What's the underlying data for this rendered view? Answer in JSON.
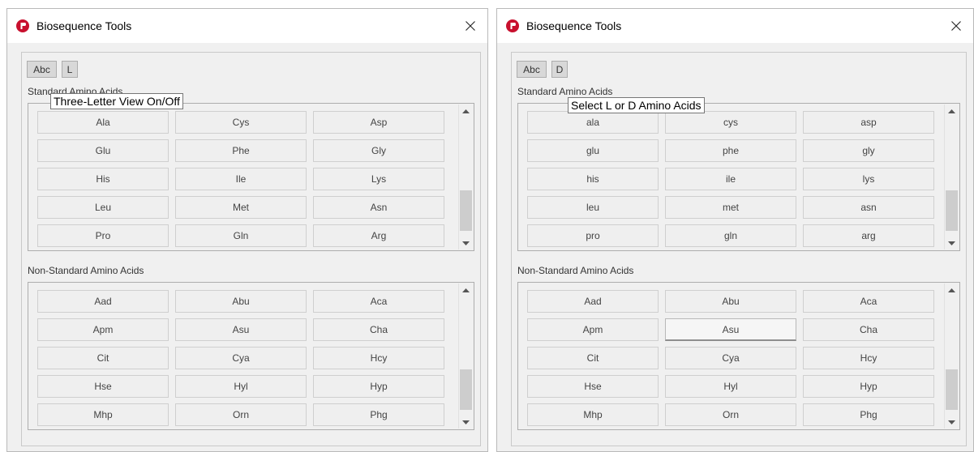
{
  "windows": [
    {
      "title": "Biosequence Tools",
      "toggle_abc": "Abc",
      "toggle_ld": "L",
      "tooltip": "Three-Letter View On/Off",
      "standard_label": "Standard Amino Acids",
      "nonstandard_label": "Non-Standard Amino Acids",
      "standard": [
        "Ala",
        "Cys",
        "Asp",
        "Glu",
        "Phe",
        "Gly",
        "His",
        "Ile",
        "Lys",
        "Leu",
        "Met",
        "Asn",
        "Pro",
        "Gln",
        "Arg"
      ],
      "nonstandard": [
        "Aad",
        "Abu",
        "Aca",
        "Apm",
        "Asu",
        "Cha",
        "Cit",
        "Cya",
        "Hcy",
        "Hse",
        "Hyl",
        "Hyp",
        "Mhp",
        "Orn",
        "Phg"
      ]
    },
    {
      "title": "Biosequence Tools",
      "toggle_abc": "Abc",
      "toggle_ld": "D",
      "tooltip": "Select L or D Amino Acids",
      "standard_label": "Standard Amino Acids",
      "nonstandard_label": "Non-Standard Amino Acids",
      "standard": [
        "ala",
        "cys",
        "asp",
        "glu",
        "phe",
        "gly",
        "his",
        "ile",
        "lys",
        "leu",
        "met",
        "asn",
        "pro",
        "gln",
        "arg"
      ],
      "nonstandard": [
        "Aad",
        "Abu",
        "Aca",
        "Apm",
        "Asu",
        "Cha",
        "Cit",
        "Cya",
        "Hcy",
        "Hse",
        "Hyl",
        "Hyp",
        "Mhp",
        "Orn",
        "Phg"
      ]
    }
  ],
  "icons": {
    "app": "app-logo-icon",
    "close": "close-icon",
    "up": "scroll-up-arrow-icon",
    "down": "scroll-down-arrow-icon"
  },
  "colors": {
    "brand": "#c8102e",
    "window_bg": "#f0f0f0",
    "button_bg": "#efefef"
  }
}
